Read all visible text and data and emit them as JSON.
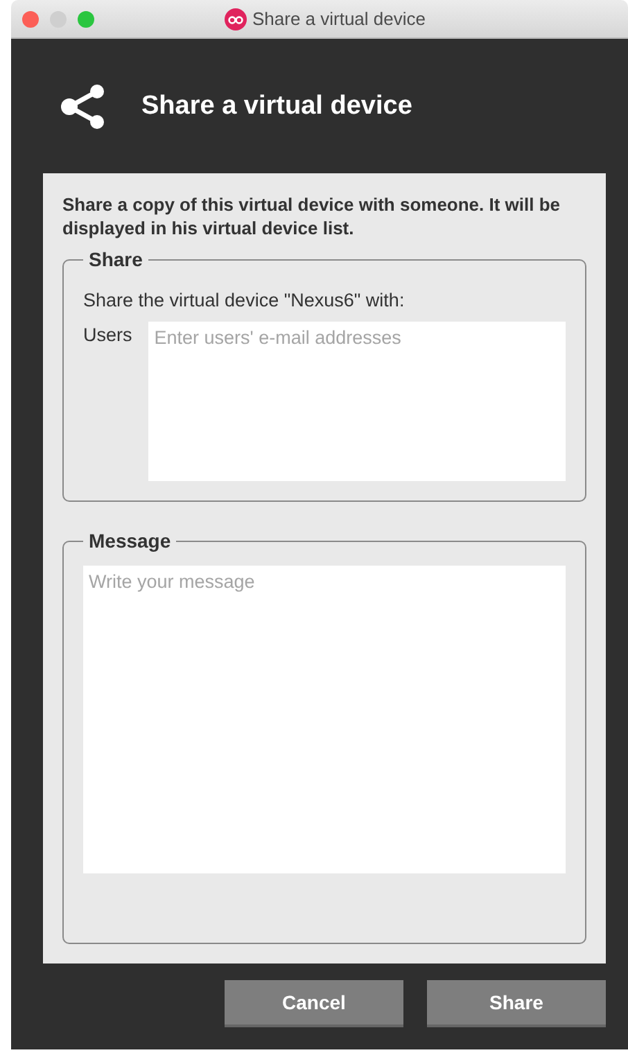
{
  "window": {
    "title": "Share a virtual device"
  },
  "header": {
    "title": "Share a virtual device"
  },
  "intro": "Share a copy of this virtual device with someone. It will be displayed in his virtual device list.",
  "share_group": {
    "legend": "Share",
    "instruction": "Share the virtual device \"Nexus6\" with:",
    "users_label": "Users",
    "users_field": {
      "placeholder": "Enter users' e-mail addresses"
    }
  },
  "message_group": {
    "legend": "Message",
    "message_field": {
      "placeholder": "Write your message"
    }
  },
  "buttons": [
    "Cancel",
    "Share"
  ]
}
